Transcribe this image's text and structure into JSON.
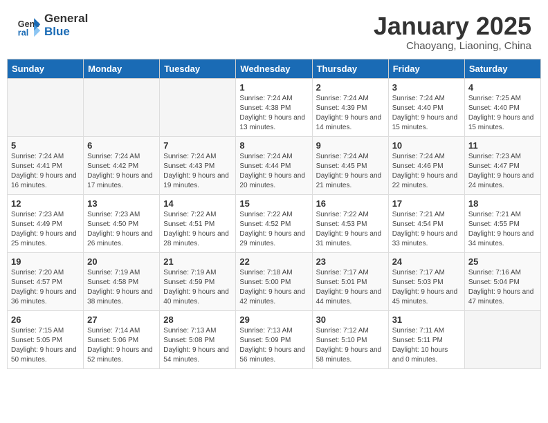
{
  "header": {
    "logo_line1": "General",
    "logo_line2": "Blue",
    "title": "January 2025",
    "subtitle": "Chaoyang, Liaoning, China"
  },
  "weekdays": [
    "Sunday",
    "Monday",
    "Tuesday",
    "Wednesday",
    "Thursday",
    "Friday",
    "Saturday"
  ],
  "weeks": [
    [
      {
        "day": "",
        "info": ""
      },
      {
        "day": "",
        "info": ""
      },
      {
        "day": "",
        "info": ""
      },
      {
        "day": "1",
        "info": "Sunrise: 7:24 AM\nSunset: 4:38 PM\nDaylight: 9 hours and 13 minutes."
      },
      {
        "day": "2",
        "info": "Sunrise: 7:24 AM\nSunset: 4:39 PM\nDaylight: 9 hours and 14 minutes."
      },
      {
        "day": "3",
        "info": "Sunrise: 7:24 AM\nSunset: 4:40 PM\nDaylight: 9 hours and 15 minutes."
      },
      {
        "day": "4",
        "info": "Sunrise: 7:25 AM\nSunset: 4:40 PM\nDaylight: 9 hours and 15 minutes."
      }
    ],
    [
      {
        "day": "5",
        "info": "Sunrise: 7:24 AM\nSunset: 4:41 PM\nDaylight: 9 hours and 16 minutes."
      },
      {
        "day": "6",
        "info": "Sunrise: 7:24 AM\nSunset: 4:42 PM\nDaylight: 9 hours and 17 minutes."
      },
      {
        "day": "7",
        "info": "Sunrise: 7:24 AM\nSunset: 4:43 PM\nDaylight: 9 hours and 19 minutes."
      },
      {
        "day": "8",
        "info": "Sunrise: 7:24 AM\nSunset: 4:44 PM\nDaylight: 9 hours and 20 minutes."
      },
      {
        "day": "9",
        "info": "Sunrise: 7:24 AM\nSunset: 4:45 PM\nDaylight: 9 hours and 21 minutes."
      },
      {
        "day": "10",
        "info": "Sunrise: 7:24 AM\nSunset: 4:46 PM\nDaylight: 9 hours and 22 minutes."
      },
      {
        "day": "11",
        "info": "Sunrise: 7:23 AM\nSunset: 4:47 PM\nDaylight: 9 hours and 24 minutes."
      }
    ],
    [
      {
        "day": "12",
        "info": "Sunrise: 7:23 AM\nSunset: 4:49 PM\nDaylight: 9 hours and 25 minutes."
      },
      {
        "day": "13",
        "info": "Sunrise: 7:23 AM\nSunset: 4:50 PM\nDaylight: 9 hours and 26 minutes."
      },
      {
        "day": "14",
        "info": "Sunrise: 7:22 AM\nSunset: 4:51 PM\nDaylight: 9 hours and 28 minutes."
      },
      {
        "day": "15",
        "info": "Sunrise: 7:22 AM\nSunset: 4:52 PM\nDaylight: 9 hours and 29 minutes."
      },
      {
        "day": "16",
        "info": "Sunrise: 7:22 AM\nSunset: 4:53 PM\nDaylight: 9 hours and 31 minutes."
      },
      {
        "day": "17",
        "info": "Sunrise: 7:21 AM\nSunset: 4:54 PM\nDaylight: 9 hours and 33 minutes."
      },
      {
        "day": "18",
        "info": "Sunrise: 7:21 AM\nSunset: 4:55 PM\nDaylight: 9 hours and 34 minutes."
      }
    ],
    [
      {
        "day": "19",
        "info": "Sunrise: 7:20 AM\nSunset: 4:57 PM\nDaylight: 9 hours and 36 minutes."
      },
      {
        "day": "20",
        "info": "Sunrise: 7:19 AM\nSunset: 4:58 PM\nDaylight: 9 hours and 38 minutes."
      },
      {
        "day": "21",
        "info": "Sunrise: 7:19 AM\nSunset: 4:59 PM\nDaylight: 9 hours and 40 minutes."
      },
      {
        "day": "22",
        "info": "Sunrise: 7:18 AM\nSunset: 5:00 PM\nDaylight: 9 hours and 42 minutes."
      },
      {
        "day": "23",
        "info": "Sunrise: 7:17 AM\nSunset: 5:01 PM\nDaylight: 9 hours and 44 minutes."
      },
      {
        "day": "24",
        "info": "Sunrise: 7:17 AM\nSunset: 5:03 PM\nDaylight: 9 hours and 45 minutes."
      },
      {
        "day": "25",
        "info": "Sunrise: 7:16 AM\nSunset: 5:04 PM\nDaylight: 9 hours and 47 minutes."
      }
    ],
    [
      {
        "day": "26",
        "info": "Sunrise: 7:15 AM\nSunset: 5:05 PM\nDaylight: 9 hours and 50 minutes."
      },
      {
        "day": "27",
        "info": "Sunrise: 7:14 AM\nSunset: 5:06 PM\nDaylight: 9 hours and 52 minutes."
      },
      {
        "day": "28",
        "info": "Sunrise: 7:13 AM\nSunset: 5:08 PM\nDaylight: 9 hours and 54 minutes."
      },
      {
        "day": "29",
        "info": "Sunrise: 7:13 AM\nSunset: 5:09 PM\nDaylight: 9 hours and 56 minutes."
      },
      {
        "day": "30",
        "info": "Sunrise: 7:12 AM\nSunset: 5:10 PM\nDaylight: 9 hours and 58 minutes."
      },
      {
        "day": "31",
        "info": "Sunrise: 7:11 AM\nSunset: 5:11 PM\nDaylight: 10 hours and 0 minutes."
      },
      {
        "day": "",
        "info": ""
      }
    ]
  ]
}
